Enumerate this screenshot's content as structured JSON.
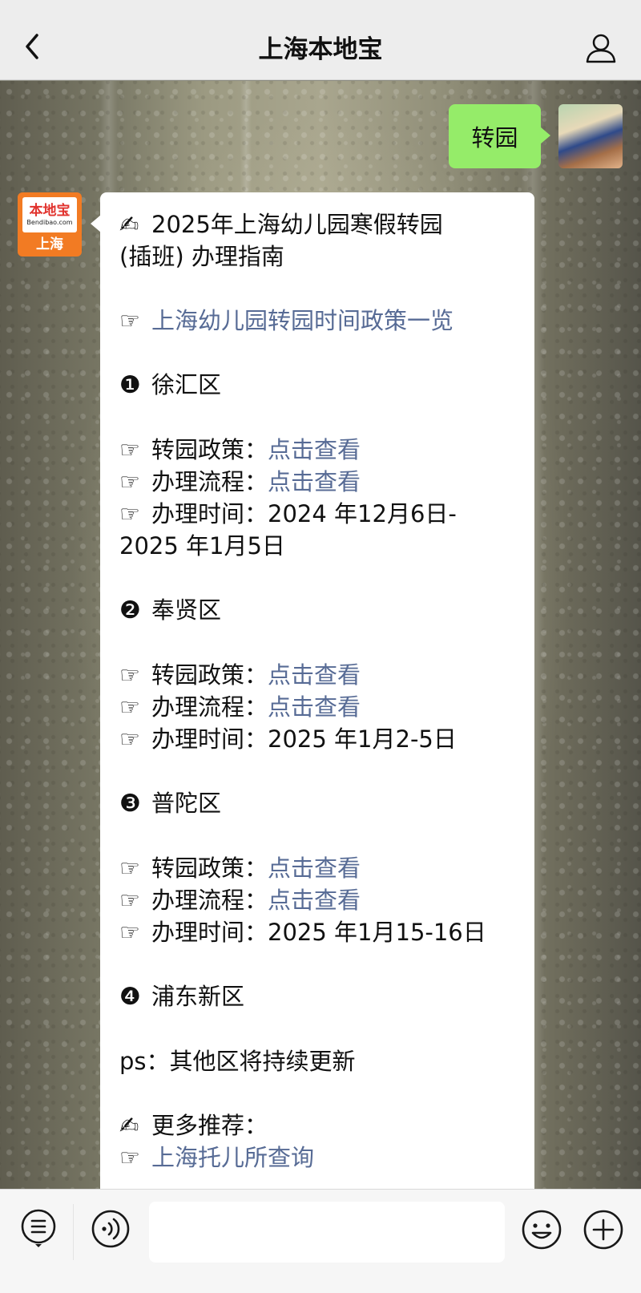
{
  "header": {
    "title": "上海本地宝"
  },
  "chat": {
    "outgoing": {
      "text": "转园"
    },
    "bot": {
      "logo_cn": "本地宝",
      "logo_en": "Bendibao.com",
      "logo_city": "上海",
      "title_icon": "✍",
      "title_line1": "2025年上海幼儿园寒假转园",
      "title_line2": "(插班) 办理指南",
      "hand_icon": "☞",
      "main_link": "上海幼儿园转园时间政策一览",
      "districts": [
        {
          "marker": "❶",
          "name": "徐汇区",
          "policy_label": "转园政策：",
          "policy_link": "点击查看",
          "process_label": "办理流程：",
          "process_link": "点击查看",
          "time_label": "办理时间：",
          "time_value_line1": "2024 年12月6日-",
          "time_value_line2": "2025 年1月5日"
        },
        {
          "marker": "❷",
          "name": "奉贤区",
          "policy_label": "转园政策：",
          "policy_link": "点击查看",
          "process_label": "办理流程：",
          "process_link": "点击查看",
          "time_label": "办理时间：",
          "time_value": "2025 年1月2-5日"
        },
        {
          "marker": "❸",
          "name": "普陀区",
          "policy_label": "转园政策：",
          "policy_link": "点击查看",
          "process_label": "办理流程：",
          "process_link": "点击查看",
          "time_label": "办理时间：",
          "time_value": "2025 年1月15-16日"
        },
        {
          "marker": "❹",
          "name": "浦东新区"
        }
      ],
      "ps": "ps：其他区将持续更新",
      "more_label": "更多推荐：",
      "more_link": "上海托儿所查询"
    }
  },
  "colors": {
    "link": "#576b95",
    "my_bubble": "#95ec69",
    "brand_orange": "#f27b23"
  }
}
